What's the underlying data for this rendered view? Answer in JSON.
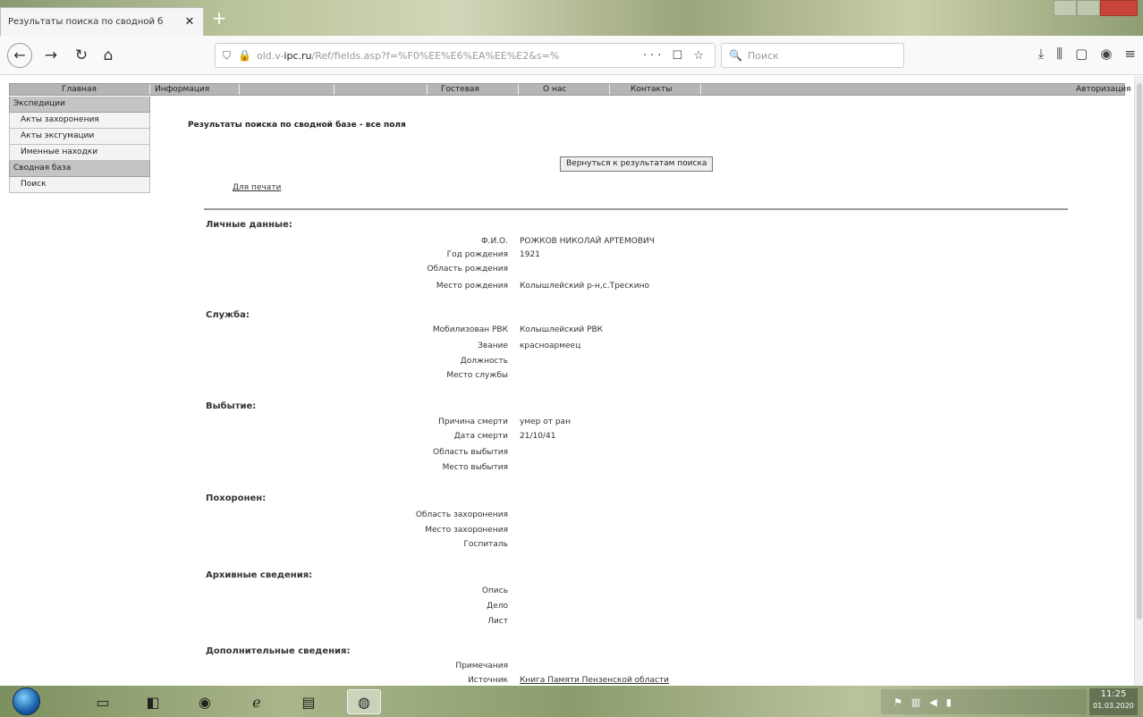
{
  "browser": {
    "tab_title": "Результаты поиска по сводной б",
    "url_prefix": "old.v-",
    "url_domain": "ipc.ru",
    "url_path": "/Ref/fields.asp?f=%F0%EE%E6%EA%EE%E2&s=%",
    "search_placeholder": "Поиск",
    "url_actions": "··· ☐ ☆"
  },
  "topmenu": {
    "home": "Главная",
    "info": "Информация",
    "guestbook": "Гостевая",
    "about": "О нас",
    "contacts": "Контакты",
    "auth": "Авторизация"
  },
  "sidebar": {
    "items": [
      {
        "label": "Экспедиции"
      },
      {
        "label": "Акты захоронения"
      },
      {
        "label": "Акты эксгумации"
      },
      {
        "label": "Именные находки"
      },
      {
        "label": "Сводная база"
      },
      {
        "label": "Поиск"
      }
    ]
  },
  "main": {
    "title": "Результаты поиска по сводной базе - все поля",
    "back_button": "Вернуться к результатам поиска",
    "print_link": "Для печати"
  },
  "sections": {
    "personal": {
      "heading": "Личные данные:",
      "rows": [
        {
          "label": "Ф.И.О.",
          "value": "РОЖКОВ НИКОЛАЙ АРТЕМОВИЧ"
        },
        {
          "label": "Год рождения",
          "value": "1921"
        },
        {
          "label": "Область рождения",
          "value": ""
        },
        {
          "label": "Место рождения",
          "value": "Колышлейский р-н,с.Трескино"
        }
      ]
    },
    "service": {
      "heading": "Служба:",
      "rows": [
        {
          "label": "Мобилизован РВК",
          "value": "Колышлейский РВК"
        },
        {
          "label": "Звание",
          "value": "красноармеец"
        },
        {
          "label": "Должность",
          "value": ""
        },
        {
          "label": "Место службы",
          "value": ""
        }
      ]
    },
    "departure": {
      "heading": "Выбытие:",
      "rows": [
        {
          "label": "Причина смерти",
          "value": "умер от ран"
        },
        {
          "label": "Дата смерти",
          "value": "21/10/41"
        },
        {
          "label": "Область выбытия",
          "value": ""
        },
        {
          "label": "Место выбытия",
          "value": ""
        }
      ]
    },
    "burial": {
      "heading": "Похоронен:",
      "rows": [
        {
          "label": "Область захоронения",
          "value": ""
        },
        {
          "label": "Место захоронения",
          "value": ""
        },
        {
          "label": "Госпиталь",
          "value": ""
        }
      ]
    },
    "archive": {
      "heading": "Архивные сведения:",
      "rows": [
        {
          "label": "Опись",
          "value": ""
        },
        {
          "label": "Дело",
          "value": ""
        },
        {
          "label": "Лист",
          "value": ""
        }
      ]
    },
    "additional": {
      "heading": "Дополнительные сведения:",
      "rows": [
        {
          "label": "Примечания",
          "value": ""
        },
        {
          "label": "Источник",
          "value": "Книга Памяти Пензенской области"
        }
      ]
    }
  },
  "taskbar": {
    "time": "11:25",
    "date": "01.03.2020"
  }
}
